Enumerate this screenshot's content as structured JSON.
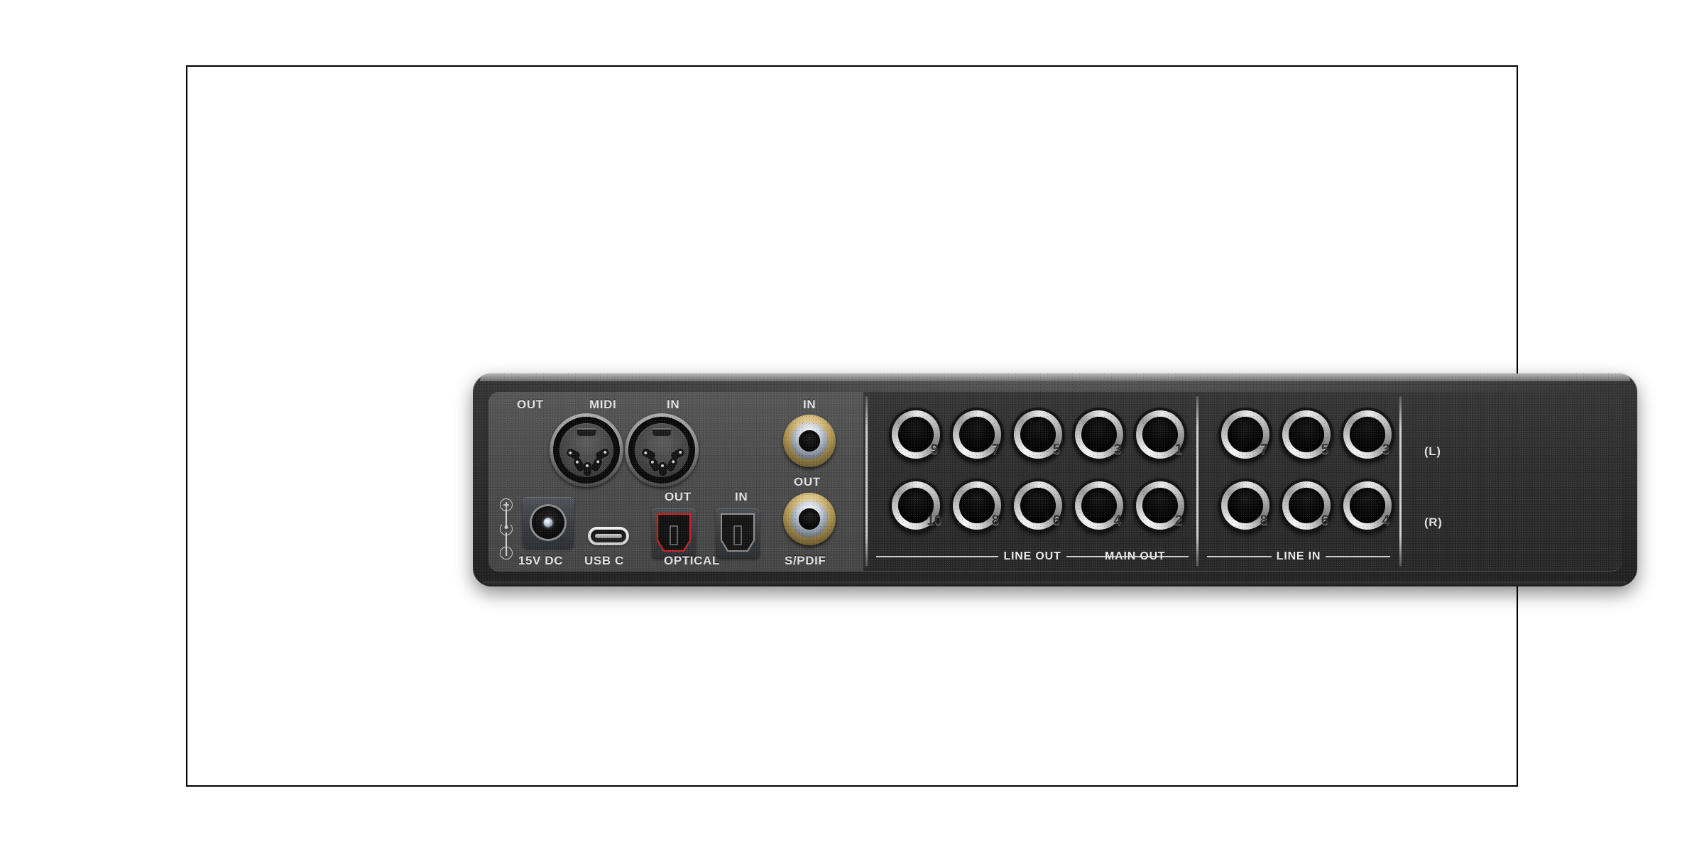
{
  "scene": {
    "subject": "audio-interface-rear-panel",
    "background_color": "#ffffff",
    "frame_border_color": "#000000",
    "chassis_color": "#2b2b2b",
    "panel_left_color": "#4b4b4b",
    "panel_jacks_color": "#2c2c2c",
    "label_color": "#e3e3e3",
    "optical_out_glow_color": "#c42020",
    "rca_gold_color": "#c8a85c"
  },
  "left_panel": {
    "midi": {
      "group_label": "MIDI",
      "out_label": "OUT",
      "in_label": "IN"
    },
    "power": {
      "label": "15V DC",
      "polarity_symbols": [
        "+",
        "center-pin",
        "-"
      ]
    },
    "usb": {
      "label": "USB C"
    },
    "optical": {
      "group_label": "OPTICAL",
      "out_label": "OUT",
      "in_label": "IN"
    },
    "spdif": {
      "group_label": "S/PDIF",
      "in_label": "IN",
      "out_label": "OUT"
    }
  },
  "jack_panel": {
    "groups": [
      {
        "name": "LINE OUT",
        "label": "LINE OUT"
      },
      {
        "name": "MAIN OUT",
        "label": "MAIN OUT"
      },
      {
        "name": "LINE IN",
        "label": "LINE IN"
      }
    ],
    "outputs_top_row": [
      "9",
      "7",
      "5",
      "3",
      "1"
    ],
    "outputs_bottom_row": [
      "10",
      "8",
      "6",
      "4",
      "2"
    ],
    "inputs_top_row": [
      "7",
      "5",
      "3"
    ],
    "inputs_bottom_row": [
      "8",
      "6",
      "4"
    ],
    "channel_markers": {
      "left": "(L)",
      "right": "(R)"
    }
  }
}
